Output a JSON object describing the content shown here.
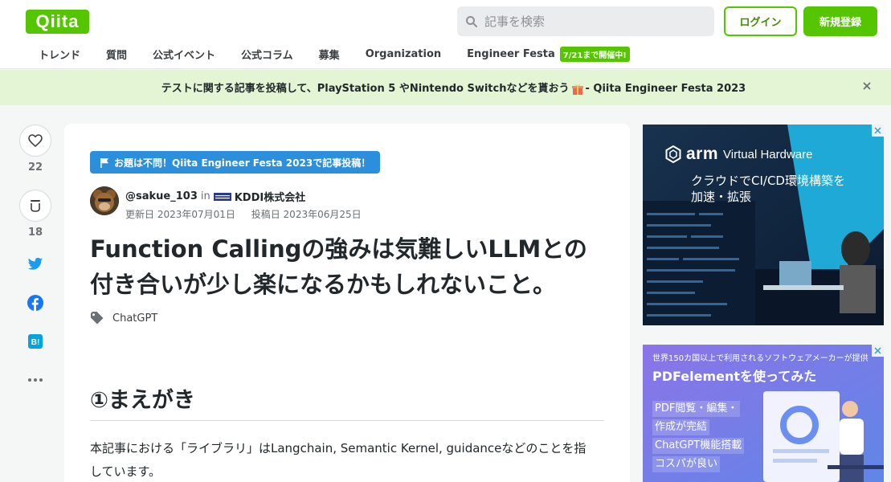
{
  "header": {
    "logo": "Qiita",
    "search_placeholder": "記事を検索",
    "login": "ログイン",
    "signup": "新規登録"
  },
  "nav": {
    "items": [
      "トレンド",
      "質問",
      "公式イベント",
      "公式コラム",
      "募集",
      "Organization",
      "Engineer Festa"
    ],
    "badge": "7/21まで開催中!"
  },
  "banner": {
    "text_before": "テストに関する記事を投稿して、PlayStation 5 やNintendo Switchなどを貰おう",
    "text_after": "- Qiita Engineer Festa 2023"
  },
  "actions": {
    "likes": "22",
    "stocks": "18"
  },
  "article": {
    "event_badge": "お題は不問！Qiita Engineer Festa 2023で記事投稿！",
    "author": "@sakue_103",
    "in": "in",
    "organization": "KDDI株式会社",
    "updated": "更新日 2023年07月01日",
    "posted": "投稿日 2023年06月25日",
    "title_line1": "Function Callingの強みは気難しいLLMとの",
    "title_line2": "付き合いが少し楽になるかもしれないこと。",
    "tag": "ChatGPT",
    "section_heading": "①まえがき",
    "body_line1": "本記事における「ライブラリ」はLangchain, Semantic Kernel, guidanceなどのことを指",
    "body_line2": "しています。"
  },
  "ads": {
    "arm_brand": "arm",
    "arm_product": "Virtual Hardware",
    "arm_line1": "クラウドでCI/CD環境構築を",
    "arm_line2": "加速・拡張",
    "pdf_top": "世界150カ国以上で利用されるソフトウェアメーカーが提供",
    "pdf_title": "PDFelementを使ってみた",
    "pdf_points": [
      "PDF閲覧・編集・",
      "作成が完結",
      "ChatGPT機能搭載",
      "コスパが良い"
    ]
  },
  "colors": {
    "brand": "#55c500",
    "banner_bg": "#e3f5d5",
    "event_blue": "#2b8fdb"
  }
}
